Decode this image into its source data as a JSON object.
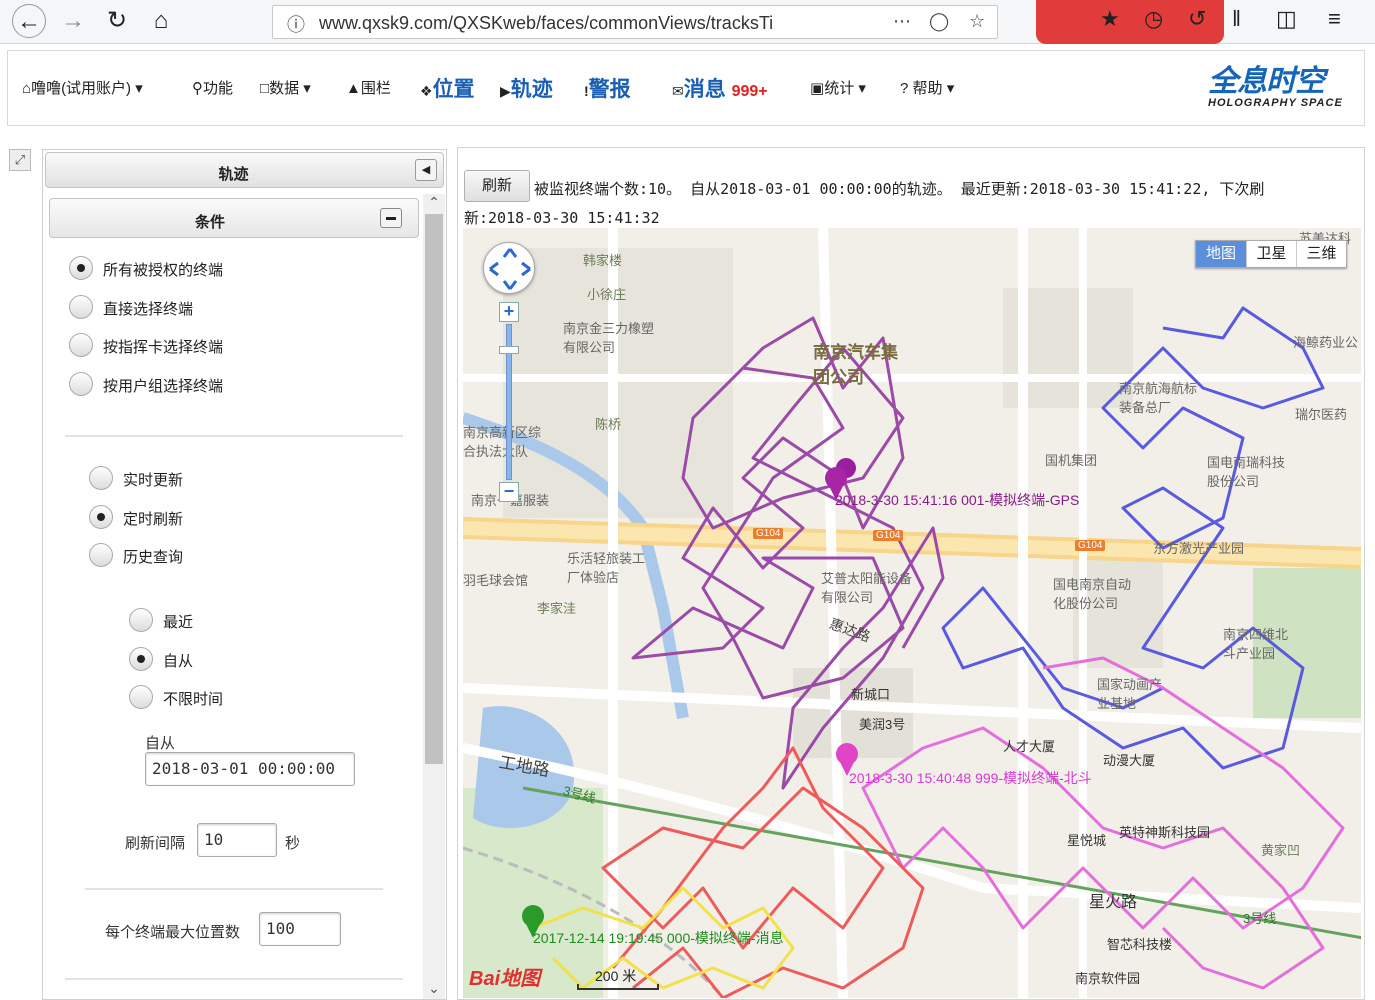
{
  "browser": {
    "url": "www.qxsk9.com/QXSKweb/faces/commonViews/tracksTi",
    "back_icon": "back-arrow-icon",
    "forward_icon": "forward-arrow-icon"
  },
  "menu": {
    "account": "噜噜(试用账户)",
    "features": "功能",
    "data": "数据",
    "fence": "围栏",
    "position": "位置",
    "track": "轨迹",
    "alarm": "警报",
    "message": "消息",
    "message_count": "999+",
    "stats": "统计",
    "help": "帮助"
  },
  "logo": {
    "main": "全息时空",
    "sub": "HOLOGRAPHY SPACE"
  },
  "left": {
    "track_title": "轨迹",
    "cond_title": "条件",
    "scope_options": [
      "所有被授权的终端",
      "直接选择终端",
      "按指挥卡选择终端",
      "按用户组选择终端"
    ],
    "mode_options": [
      "实时更新",
      "定时刷新",
      "历史查询"
    ],
    "time_options": [
      "最近",
      "自从",
      "不限时间"
    ],
    "since_label": "自从",
    "since_value": "2018-03-01 00:00:00",
    "interval_label": "刷新间隔",
    "interval_value": "10",
    "interval_unit": "秒",
    "max_label": "每个终端最大位置数",
    "max_value": "100"
  },
  "right": {
    "refresh_label": "刷新",
    "status_line1": "被监视终端个数:10。 自从2018-03-01 00:00:00的轨迹。 最近更新:2018-03-30 15:41:22, 下次刷",
    "status_line2": "新:2018-03-30 15:41:32"
  },
  "map": {
    "types": [
      "地图",
      "卫星",
      "三维"
    ],
    "scale": "200 米",
    "baidu": "Bai地图",
    "track_labels": [
      {
        "text": "2018-3-30 15:41:16 001-模拟终端-GPS",
        "color": "#8a1a8a"
      },
      {
        "text": "2018-3-30 15:40:48 999-模拟终端-北斗",
        "color": "#d63ad6"
      },
      {
        "text": "2017-12-14 19:19:45 000-模拟终端-消息",
        "color": "#1f8a1f"
      }
    ],
    "places": {
      "hanjialou": "韩家楼",
      "xiaoxuzhuang": "小徐庄",
      "jinsanli": "南京金三力橡塑有限公司",
      "nanqi": "南京汽车集团公司",
      "chenqiao": "陈桥",
      "gaoxin": "南京高新区综合执法大队",
      "yujia": "南京一嘉服装",
      "lehuo": "乐活轻旅装工厂体验店",
      "yumao": "羽毛球会馆",
      "lijiawa": "李家洼",
      "aipu": "艾普太阳能设备有限公司",
      "huida": "惠达路",
      "guoji": "国机集团",
      "guodian_rui": "国电南瑞科技股份公司",
      "guodian_zd": "国电南京自动化股份公司",
      "dongfang": "东方激光产业园",
      "nanjing_sw": "南京四维北斗产业园",
      "guojia_dm": "国家动画产业基地",
      "rencai": "人才大厦",
      "dongman": "动漫大厦",
      "yingte": "英特神斯科技园",
      "xingyuecheng": "星悦城",
      "xinghuo": "星火路",
      "zhixin": "智芯科技楼",
      "ruanjian": "南京软件园",
      "huangjiaao": "黄家凹",
      "gongdi": "工地路",
      "line3a": "3号线",
      "line3b": "3号线",
      "ruier": "瑞尔医药",
      "haijing": "海鲸药业公",
      "nanjing_hb": "南京航海航标装备总厂",
      "meirun": "美润3号",
      "jindaokou": "新城口",
      "meijing": "苏美达科",
      "g104a": "G104",
      "g104b": "G104",
      "g104c": "G104"
    }
  }
}
